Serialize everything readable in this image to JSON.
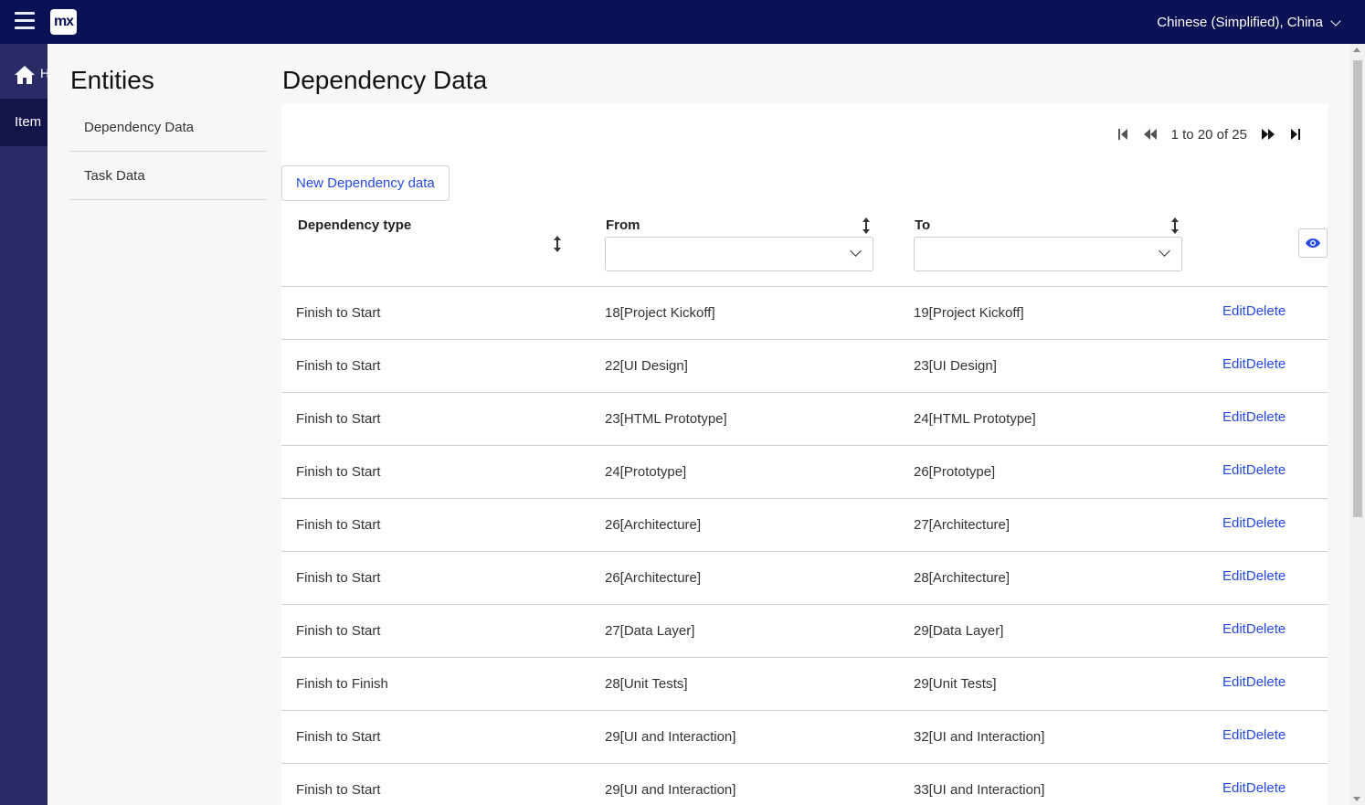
{
  "header": {
    "logo_text": "mx",
    "language": "Chinese (Simplified), China"
  },
  "rail": {
    "home_label": "H",
    "item_label": "Item"
  },
  "entities": {
    "title": "Entities",
    "links": [
      "Dependency Data",
      "Task Data"
    ]
  },
  "main": {
    "title": "Dependency Data",
    "pager_text": "1 to 20 of 25",
    "new_button": "New Dependency data",
    "columns": {
      "type": "Dependency type",
      "from": "From",
      "to": "To"
    },
    "action_edit": "Edit",
    "action_delete": "Delete",
    "rows": [
      {
        "type": "Finish to Start",
        "from": "18[Project Kickoff]",
        "to": "19[Project Kickoff]"
      },
      {
        "type": "Finish to Start",
        "from": "22[UI Design]",
        "to": "23[UI Design]"
      },
      {
        "type": "Finish to Start",
        "from": "23[HTML Prototype]",
        "to": "24[HTML Prototype]"
      },
      {
        "type": "Finish to Start",
        "from": "24[Prototype]",
        "to": "26[Prototype]"
      },
      {
        "type": "Finish to Start",
        "from": "26[Architecture]",
        "to": "27[Architecture]"
      },
      {
        "type": "Finish to Start",
        "from": "26[Architecture]",
        "to": "28[Architecture]"
      },
      {
        "type": "Finish to Start",
        "from": "27[Data Layer]",
        "to": "29[Data Layer]"
      },
      {
        "type": "Finish to Finish",
        "from": "28[Unit Tests]",
        "to": "29[Unit Tests]"
      },
      {
        "type": "Finish to Start",
        "from": "29[UI and Interaction]",
        "to": "32[UI and Interaction]"
      },
      {
        "type": "Finish to Start",
        "from": "29[UI and Interaction]",
        "to": "33[UI and Interaction]"
      }
    ]
  },
  "colors": {
    "topbar": "#0a1154",
    "rail": "#2a2a66",
    "accent": "#264ae5"
  }
}
